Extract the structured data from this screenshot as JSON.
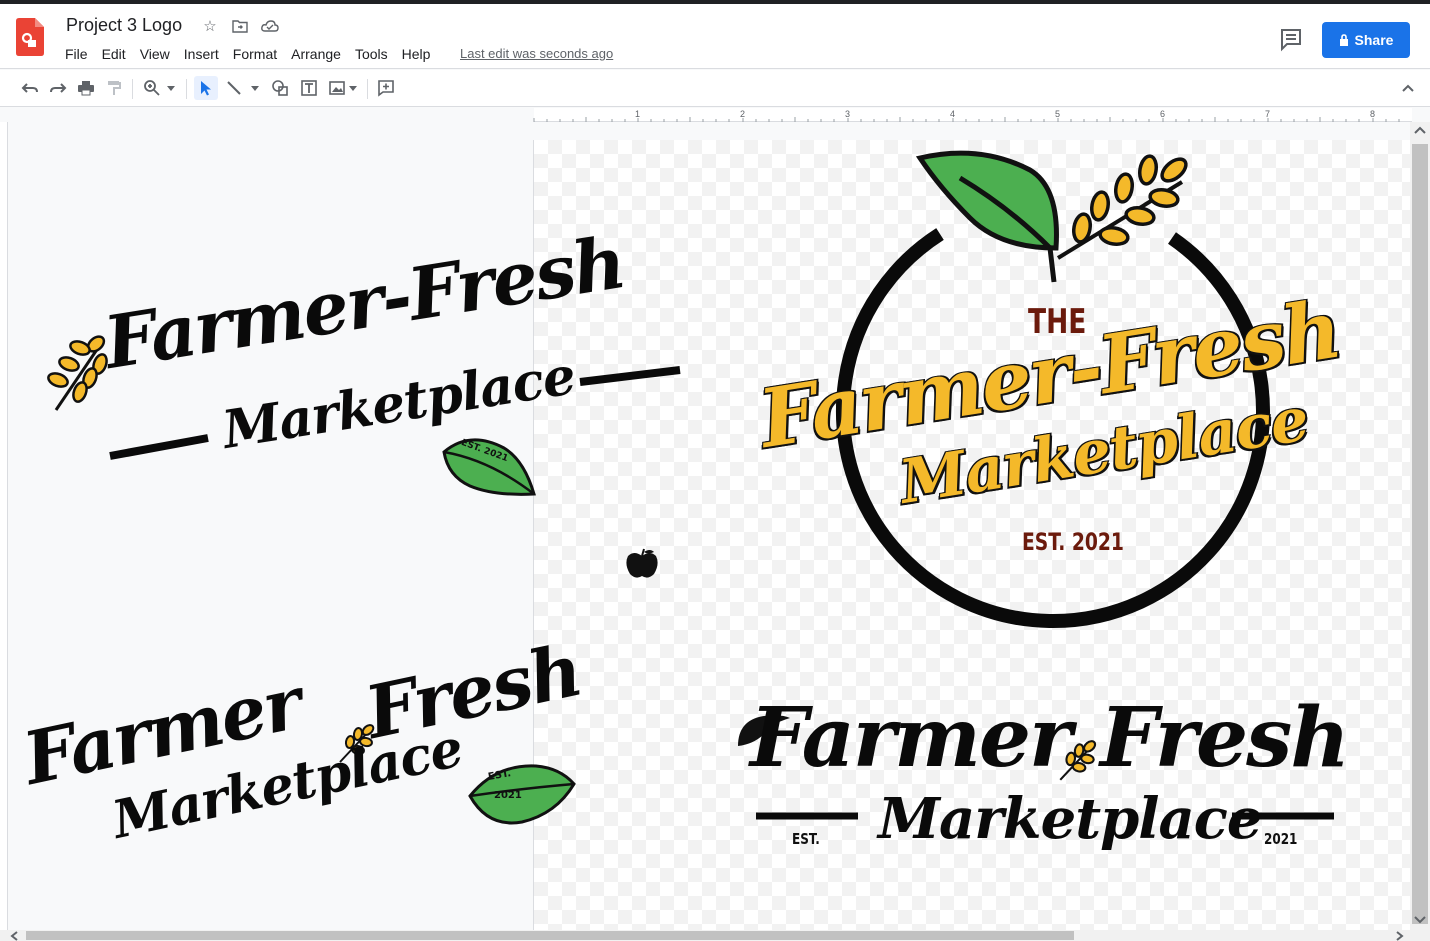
{
  "header": {
    "title": "Project 3 Logo",
    "menus": [
      "File",
      "Edit",
      "View",
      "Insert",
      "Format",
      "Arrange",
      "Tools",
      "Help"
    ],
    "last_edit": "Last edit was seconds ago",
    "share_label": "Share"
  },
  "ruler": {
    "marks": [
      "1",
      "2",
      "3",
      "4",
      "5",
      "6",
      "7",
      "8"
    ]
  },
  "logos": {
    "logo1": {
      "line1": "Farmer-Fresh",
      "line2": "Marketplace",
      "est": "EST. 2021"
    },
    "logo2": {
      "the": "THE",
      "line1": "Farmer-Fresh",
      "line2": "Marketplace",
      "est": "EST. 2021"
    },
    "logo3": {
      "word1": "Farmer",
      "word2": "Fresh",
      "line2": "Marketplace",
      "est1": "EST.",
      "est2": "2021"
    },
    "logo4": {
      "word1": "Farmer",
      "word2": "Fresh",
      "line2": "Marketplace",
      "est1": "EST.",
      "est2": "2021"
    }
  },
  "colors": {
    "accent": "#1a73e8",
    "gold": "#f4b92a",
    "leaf": "#4caf50",
    "maroon": "#6b1a0c",
    "ink": "#0a0a0a"
  }
}
